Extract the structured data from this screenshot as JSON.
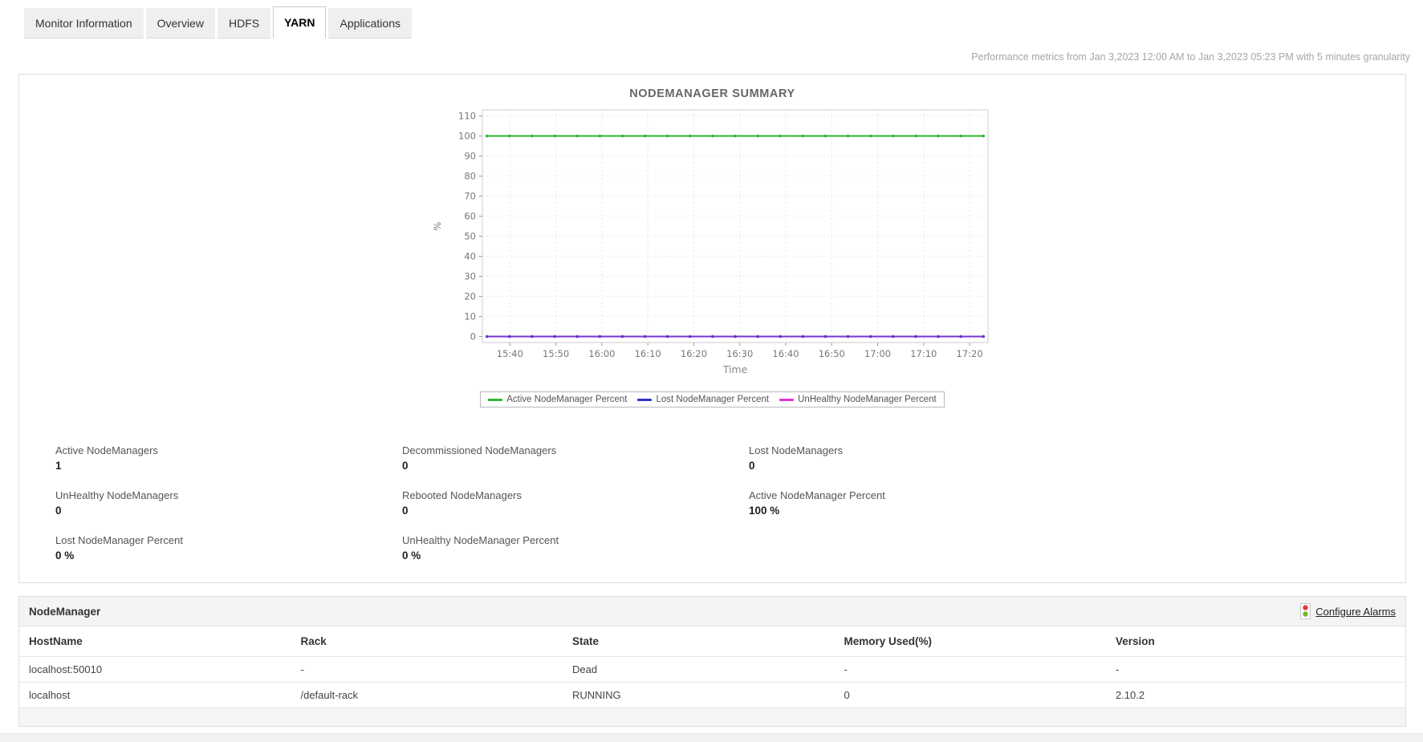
{
  "tabs": [
    {
      "label": "Monitor Information",
      "active": false
    },
    {
      "label": "Overview",
      "active": false
    },
    {
      "label": "HDFS",
      "active": false
    },
    {
      "label": "YARN",
      "active": true
    },
    {
      "label": "Applications",
      "active": false
    }
  ],
  "header": {
    "performance_note": "Performance metrics from Jan 3,2023 12:00 AM to Jan 3,2023 05:23 PM with 5 minutes granularity"
  },
  "chart_data": {
    "type": "line",
    "title": "NODEMANAGER SUMMARY",
    "xlabel": "Time",
    "ylabel": "%",
    "ylim": [
      0,
      110
    ],
    "y_ticks": [
      0,
      10,
      20,
      30,
      40,
      50,
      60,
      70,
      80,
      90,
      100,
      110
    ],
    "x_ticks": [
      "15:40",
      "15:50",
      "16:00",
      "16:10",
      "16:20",
      "16:30",
      "16:40",
      "16:50",
      "17:00",
      "17:10",
      "17:20"
    ],
    "x_range": [
      "15:35",
      "17:23"
    ],
    "interval_minutes": 5,
    "grid": true,
    "legend_position": "bottom",
    "series": [
      {
        "name": "Active NodeManager Percent",
        "color": "#2eb82e",
        "values": [
          100,
          100,
          100,
          100,
          100,
          100,
          100,
          100,
          100,
          100,
          100,
          100,
          100,
          100,
          100,
          100,
          100,
          100,
          100,
          100,
          100,
          100,
          100
        ]
      },
      {
        "name": "Lost NodeManager Percent",
        "color": "#3333cc",
        "values": [
          0,
          0,
          0,
          0,
          0,
          0,
          0,
          0,
          0,
          0,
          0,
          0,
          0,
          0,
          0,
          0,
          0,
          0,
          0,
          0,
          0,
          0,
          0
        ]
      },
      {
        "name": "UnHealthy NodeManager Percent",
        "color": "#e632d6",
        "values": [
          0,
          0,
          0,
          0,
          0,
          0,
          0,
          0,
          0,
          0,
          0,
          0,
          0,
          0,
          0,
          0,
          0,
          0,
          0,
          0,
          0,
          0,
          0
        ]
      }
    ]
  },
  "metrics": [
    {
      "label": "Active NodeManagers",
      "value": "1"
    },
    {
      "label": "Decommissioned NodeManagers",
      "value": "0"
    },
    {
      "label": "Lost NodeManagers",
      "value": "0"
    },
    {
      "label": "UnHealthy NodeManagers",
      "value": "0"
    },
    {
      "label": "Rebooted NodeManagers",
      "value": "0"
    },
    {
      "label": "Active NodeManager Percent",
      "value": "100 %"
    },
    {
      "label": "Lost NodeManager Percent",
      "value": "0 %"
    },
    {
      "label": "UnHealthy NodeManager Percent",
      "value": "0 %"
    }
  ],
  "table": {
    "title": "NodeManager",
    "configure_alarms": "Configure Alarms",
    "columns": [
      "HostName",
      "Rack",
      "State",
      "Memory Used(%)",
      "Version"
    ],
    "rows": [
      [
        "localhost:50010",
        "-",
        "Dead",
        "-",
        "-"
      ],
      [
        "localhost",
        "/default-rack",
        "RUNNING",
        "0",
        "2.10.2"
      ]
    ]
  },
  "colors": {
    "series_green": "#2eb82e",
    "series_blue": "#3333cc",
    "series_magenta": "#e632d6",
    "alarm_icon_red": "#e23b3b",
    "alarm_icon_green": "#76b82a"
  }
}
